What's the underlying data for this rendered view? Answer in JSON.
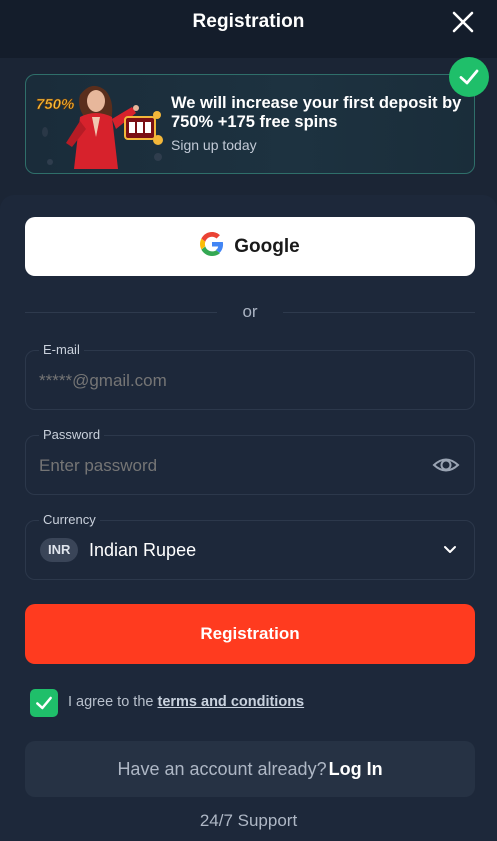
{
  "header": {
    "title": "Registration"
  },
  "promo": {
    "badge_text": "750%",
    "headline": "We will increase your first deposit by 750% +175 free spins",
    "subtext": "Sign up today"
  },
  "social": {
    "google_label": "Google"
  },
  "divider": {
    "text": "or"
  },
  "email": {
    "label": "E-mail",
    "placeholder": "*****@gmail.com"
  },
  "password": {
    "label": "Password",
    "placeholder": "Enter password"
  },
  "currency": {
    "label": "Currency",
    "code": "INR",
    "name": "Indian Rupee"
  },
  "register": {
    "button_label": "Registration"
  },
  "agreement": {
    "prefix": "I agree to the ",
    "link": "terms and conditions",
    "checked": true
  },
  "login": {
    "prompt": "Have an account already?",
    "link": "Log In"
  },
  "footer": {
    "support": "24/7 Support"
  },
  "colors": {
    "background": "#1b2535",
    "accent_red": "#ff3b1f",
    "success_green": "#1fbf6a",
    "field_border": "#2c384b"
  },
  "icons": {
    "close": "close-icon",
    "check": "check-icon",
    "google": "google-logo-icon",
    "eye": "eye-icon",
    "chevron": "chevron-down-icon"
  }
}
